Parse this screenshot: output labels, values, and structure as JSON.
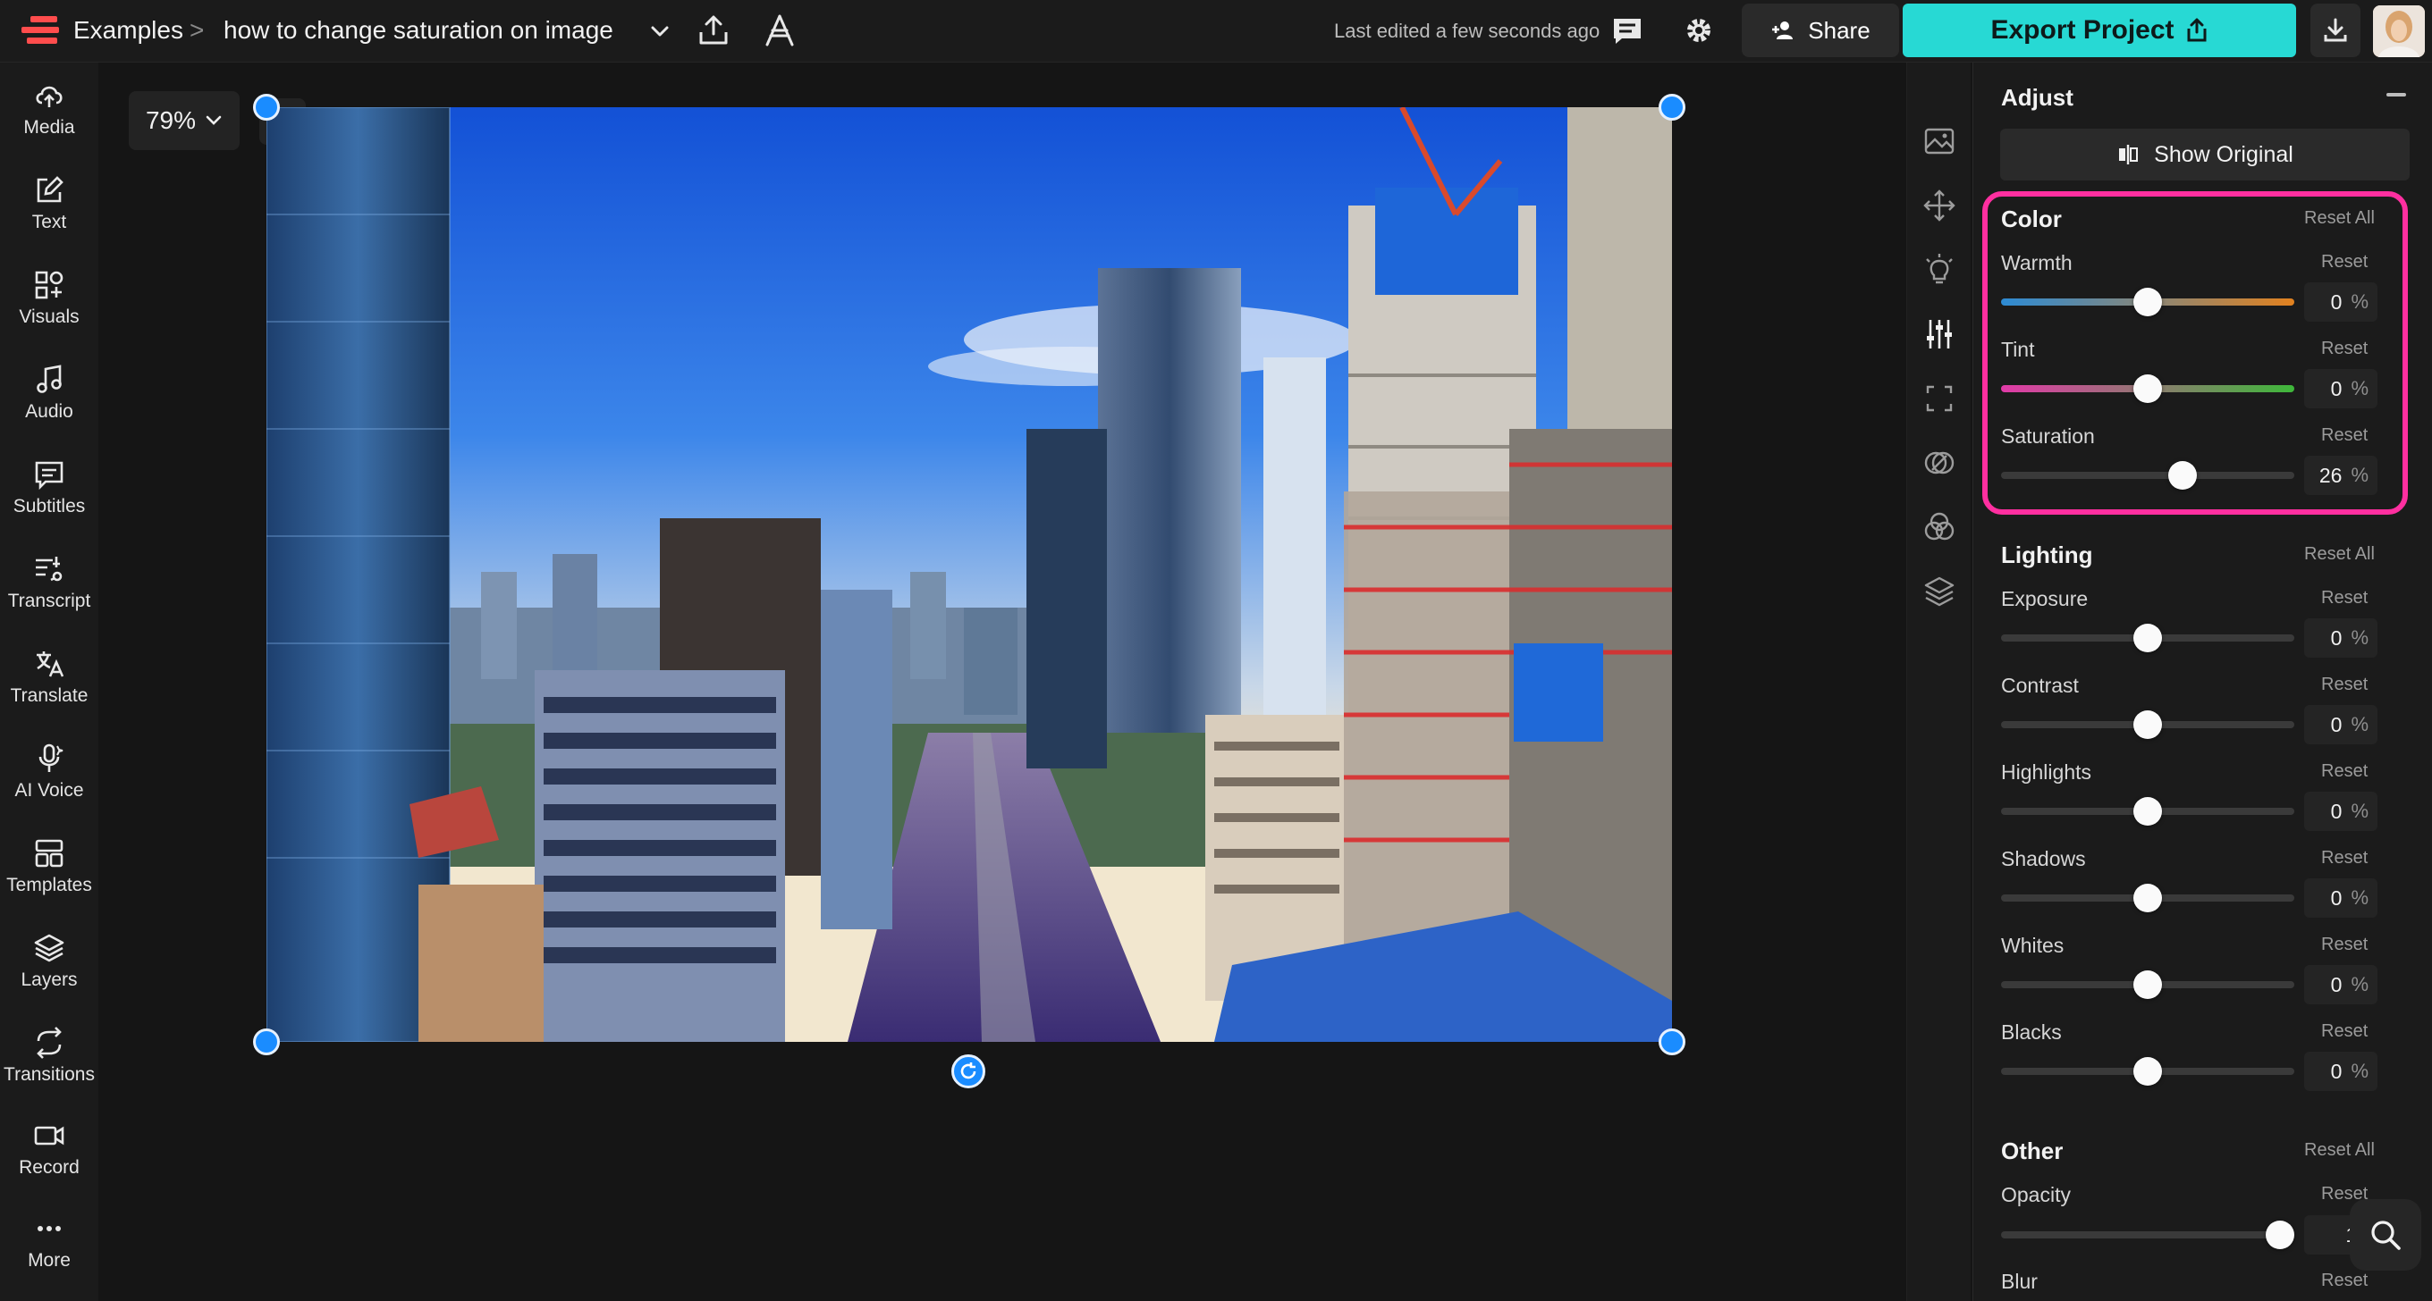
{
  "topbar": {
    "breadcrumb_root": "Examples",
    "breadcrumb_sep": ">",
    "project_name": "how to change saturation on image",
    "last_edited": "Last edited a few seconds ago",
    "share_label": "Share",
    "export_label": "Export Project"
  },
  "sidebar": {
    "items": [
      {
        "label": "Media",
        "icon": "upload-cloud-icon"
      },
      {
        "label": "Text",
        "icon": "pencil-square-icon"
      },
      {
        "label": "Visuals",
        "icon": "shapes-grid-icon"
      },
      {
        "label": "Audio",
        "icon": "music-note-icon"
      },
      {
        "label": "Subtitles",
        "icon": "subtitles-icon"
      },
      {
        "label": "Transcript",
        "icon": "transcript-icon"
      },
      {
        "label": "Translate",
        "icon": "translate-icon"
      },
      {
        "label": "AI Voice",
        "icon": "microphone-icon"
      },
      {
        "label": "Templates",
        "icon": "templates-icon"
      },
      {
        "label": "Layers",
        "icon": "layers-icon"
      },
      {
        "label": "Transitions",
        "icon": "transitions-icon"
      },
      {
        "label": "Record",
        "icon": "record-camera-icon"
      },
      {
        "label": "More",
        "icon": "more-dots-icon"
      }
    ]
  },
  "canvas": {
    "zoom": "79%"
  },
  "tool_rail": {
    "icons": [
      "image-icon",
      "move-icon",
      "light-bulb-icon",
      "adjust-sliders-icon",
      "crop-frame-icon",
      "filter-rings-icon",
      "color-circles-icon",
      "layers-stack-icon"
    ]
  },
  "adjust_panel": {
    "title": "Adjust",
    "show_original": "Show Original",
    "percent": "%",
    "reset": "Reset",
    "reset_all": "Reset All",
    "color": {
      "title": "Color",
      "params": [
        {
          "label": "Warmth",
          "value": "0"
        },
        {
          "label": "Tint",
          "value": "0"
        },
        {
          "label": "Saturation",
          "value": "26"
        }
      ]
    },
    "lighting": {
      "title": "Lighting",
      "params": [
        {
          "label": "Exposure",
          "value": "0"
        },
        {
          "label": "Contrast",
          "value": "0"
        },
        {
          "label": "Highlights",
          "value": "0"
        },
        {
          "label": "Shadows",
          "value": "0"
        },
        {
          "label": "Whites",
          "value": "0"
        },
        {
          "label": "Blacks",
          "value": "0"
        }
      ]
    },
    "other": {
      "title": "Other",
      "params": [
        {
          "label": "Opacity",
          "value": "10"
        },
        {
          "label": "Blur",
          "value": ""
        }
      ]
    }
  },
  "colors": {
    "accent_export": "#27d9d4",
    "highlight_pink": "#ff2fa0",
    "handle_blue": "#1a8cff"
  }
}
